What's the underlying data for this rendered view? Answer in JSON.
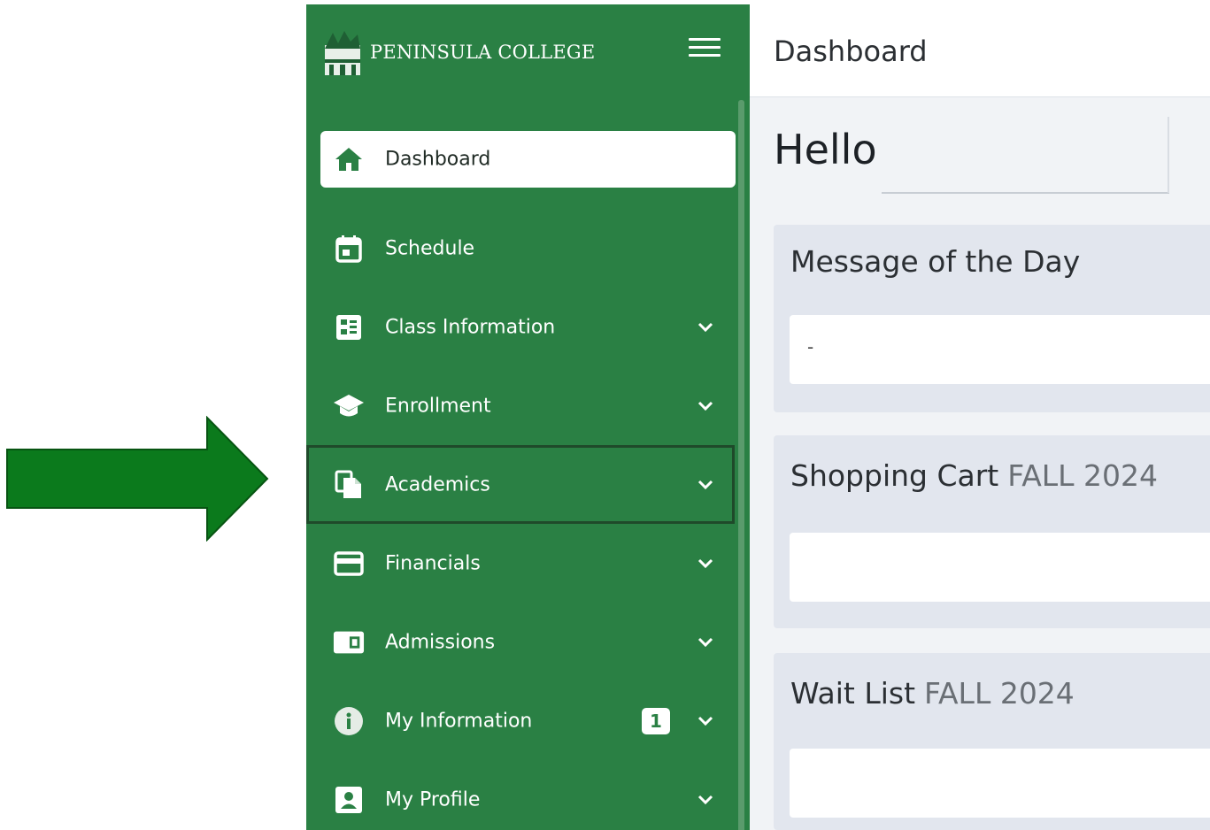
{
  "brand": {
    "name": "PENINSULA COLLEGE"
  },
  "colors": {
    "sidebar": "#2a8044",
    "arrow": "#0b7a1c",
    "content_bg": "#f1f3f6",
    "card_bg": "#e2e6ee"
  },
  "nav": {
    "items": [
      {
        "label": "Dashboard",
        "icon": "home-icon",
        "active": true
      },
      {
        "label": "Schedule",
        "icon": "calendar-icon"
      },
      {
        "label": "Class Information",
        "icon": "class-list-icon",
        "expandable": true
      },
      {
        "label": "Enrollment",
        "icon": "graduation-cap-icon",
        "expandable": true
      },
      {
        "label": "Academics",
        "icon": "documents-icon",
        "expandable": true,
        "highlighted": true
      },
      {
        "label": "Financials",
        "icon": "credit-card-icon",
        "expandable": true
      },
      {
        "label": "Admissions",
        "icon": "id-card-icon",
        "expandable": true
      },
      {
        "label": "My Information",
        "icon": "info-icon",
        "expandable": true,
        "badge": "1"
      },
      {
        "label": "My Profile",
        "icon": "profile-icon",
        "expandable": true
      }
    ]
  },
  "topbar": {
    "title": "Dashboard"
  },
  "main": {
    "greeting": "Hello",
    "cards": [
      {
        "title": "Message of the Day",
        "term": "",
        "value": "-"
      },
      {
        "title": "Shopping Cart",
        "term": "FALL 2024",
        "value": ""
      },
      {
        "title": "Wait List",
        "term": "FALL 2024",
        "value": ""
      }
    ]
  }
}
